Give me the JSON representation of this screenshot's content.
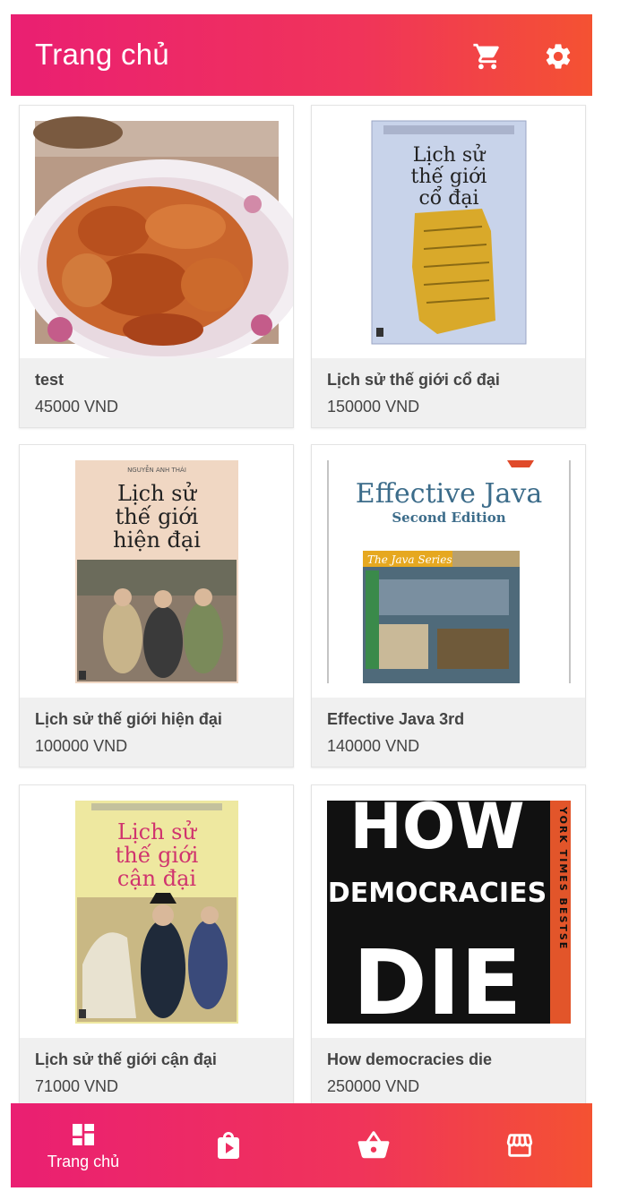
{
  "appbar": {
    "title": "Trang chủ",
    "cart_icon": "cart-icon",
    "settings_icon": "gear-icon"
  },
  "products": [
    {
      "name": "test",
      "price": "45000 VND",
      "image": "fried-chicken-photo"
    },
    {
      "name": "Lịch sử thế giới cổ đại",
      "price": "150000 VND",
      "image": "book-cover",
      "cover": {
        "title_line1": "Lịch sử",
        "title_line2": "thế giới",
        "title_line3": "cổ đại"
      }
    },
    {
      "name": "Lịch sử thế giới hiện đại",
      "price": "100000 VND",
      "image": "book-cover",
      "cover": {
        "author": "NGUYỄN ANH THÁI",
        "title_line1": "Lịch sử",
        "title_line2": "thế giới",
        "title_line3": "hiện đại"
      }
    },
    {
      "name": "Effective Java 3rd",
      "price": "140000 VND",
      "image": "book-cover",
      "cover": {
        "title": "Effective Java",
        "subtitle": "Second Edition",
        "series": "The Java Series"
      }
    },
    {
      "name": "Lịch sử thế giới cận đại",
      "price": "71000 VND",
      "image": "book-cover",
      "cover": {
        "title_line1": "Lịch sử",
        "title_line2": "thế giới",
        "title_line3": "cận đại"
      }
    },
    {
      "name": "How democracies die",
      "price": "250000 VND",
      "image": "book-cover",
      "cover": {
        "word_top": "HOW",
        "word_mid": "DEMOCRACIES",
        "word_bottom": "DIE",
        "side": "YORK TIMES BESTSE"
      }
    }
  ],
  "bottom_nav": {
    "items": [
      {
        "label": "Trang chủ",
        "icon": "dashboard-icon",
        "active": true
      },
      {
        "label": "",
        "icon": "shopping-bag-play-icon",
        "active": false
      },
      {
        "label": "",
        "icon": "basket-icon",
        "active": false
      },
      {
        "label": "",
        "icon": "store-icon",
        "active": false
      }
    ]
  },
  "colors": {
    "accent_start": "#ea1f72",
    "accent_end": "#f45232",
    "card_info_bg": "#f0f0f0",
    "text": "#444444"
  }
}
